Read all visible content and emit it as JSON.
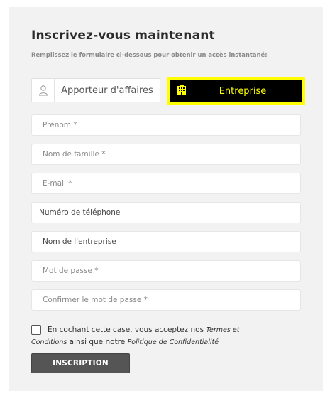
{
  "form": {
    "title": "Inscrivez-vous maintenant",
    "subtitle": "Remplissez le formulaire ci-dessous pour obtenir un accès instantané:"
  },
  "account_type": {
    "options": [
      {
        "label": "Apporteur d'affaires",
        "icon": "user-icon",
        "selected": false
      },
      {
        "label": "Entreprise",
        "icon": "building-icon",
        "selected": true
      }
    ],
    "selected_colors": {
      "background": "#000000",
      "text": "#ffff00",
      "border": "#ffff00"
    }
  },
  "fields": {
    "first_name": "Prénom *",
    "last_name": "Nom de famille *",
    "email": "E-mail *",
    "phone": "Numéro de téléphone",
    "company": "Nom de l'entreprise",
    "password": "Mot de passe *",
    "confirm_password": "Confirmer le mot de passe *"
  },
  "consent": {
    "text_before": "En cochant cette case, vous acceptez nos ",
    "terms_part1": "Termes et",
    "terms_part2": "Conditions",
    "text_middle": " ainsi que notre ",
    "privacy": "Politique de Confidentialité",
    "checked": false
  },
  "submit_label": "INSCRIPTION"
}
